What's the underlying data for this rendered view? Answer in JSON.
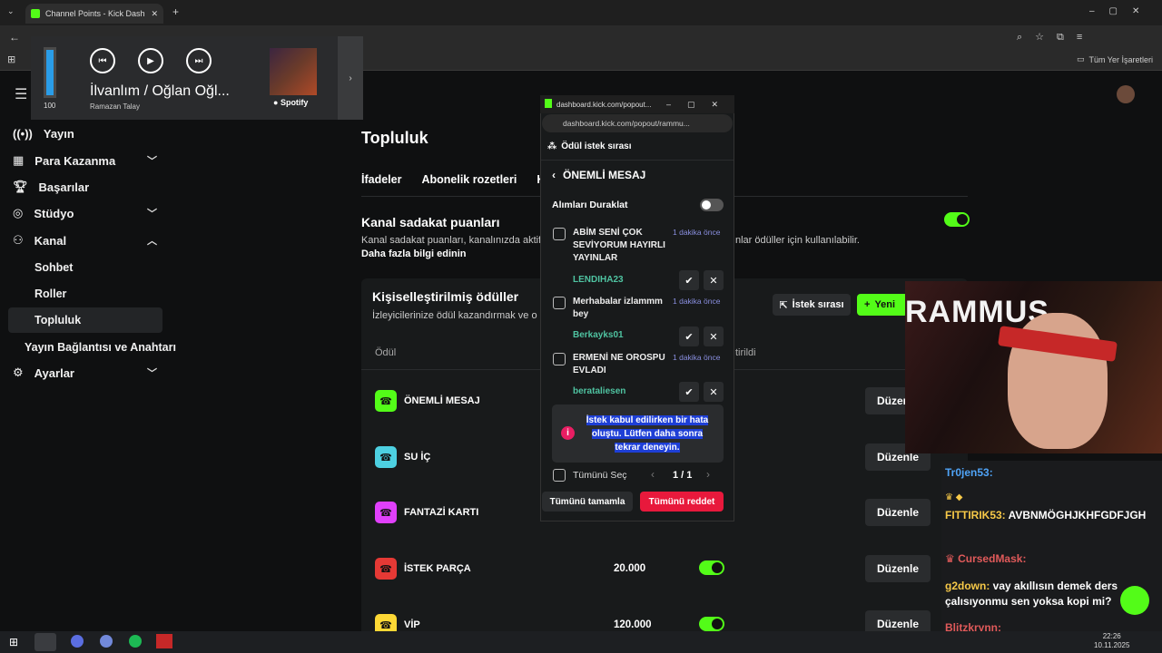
{
  "browser": {
    "tab_title": "Channel Points - Kick Dashboa",
    "bookmark_label": "Tüm Yer İşaretleri"
  },
  "spotify": {
    "volume": "100",
    "song_title": "İlvanlım / Oğlan Oğl...",
    "artist": "Ramazan Talay",
    "brand": "Spotify"
  },
  "nav": {
    "items": [
      {
        "label": "Yayın"
      },
      {
        "label": "Para Kazanma"
      },
      {
        "label": "Başarılar"
      },
      {
        "label": "Stüdyo"
      },
      {
        "label": "Kanal"
      }
    ],
    "sub_items": [
      {
        "label": "Sohbet"
      },
      {
        "label": "Roller"
      },
      {
        "label": "Topluluk"
      }
    ],
    "link": "Yayın Bağlantısı ve Anahtarı",
    "settings": "Ayarlar"
  },
  "main": {
    "title": "Topluluk",
    "tabs": [
      "İfadeler",
      "Abonelik rozetleri",
      "K"
    ],
    "loyalty_title": "Kanal sadakat puanları",
    "loyalty_desc_left": "Kanal sadakat puanları, kanalınızda aktif",
    "loyalty_desc_right": "nlar ödüller için kullanılabilir.",
    "loyalty_link": "Daha fazla bilgi edinin",
    "rewards_title": "Kişiselleştirilmiş ödüller",
    "rewards_desc": "İzleyicilerinize ödül kazandırmak ve o",
    "queue_button": "İstek sırası",
    "new_button": "Yeni",
    "col_reward": "Ödül",
    "col_status": "tirildi",
    "edit_label": "Düzenle",
    "rewards": [
      {
        "name": "ÖNEMLİ MESAJ",
        "cost": "",
        "color": "#53fc18"
      },
      {
        "name": "SU İÇ",
        "cost": "",
        "color": "#4dd0e1"
      },
      {
        "name": "FANTAZİ KARTI",
        "cost": "",
        "color": "#e040fb"
      },
      {
        "name": "İSTEK PARÇA",
        "cost": "20.000",
        "color": "#e53935"
      },
      {
        "name": "VİP",
        "cost": "120.000",
        "color": "#fdd835"
      }
    ]
  },
  "popout": {
    "window_title": "dashboard.kick.com/popout...",
    "url": "dashboard.kick.com/popout/rammu...",
    "header": "Ödül istek sırası",
    "reward_name": "ÖNEMLİ MESAJ",
    "pause_label": "Alımları Duraklat",
    "requests": [
      {
        "message": "ABİM SENİ ÇOK SEVİYORUM HAYIRLI YAYINLAR",
        "time": "1 dakika önce",
        "user": "LENDIHA23"
      },
      {
        "message": "Merhabalar izlammm bey",
        "time": "1 dakika önce",
        "user": "Berkayks01"
      },
      {
        "message": "ERMENİ NE OROSPU EVLADI",
        "time": "1 dakika önce",
        "user": "berataliesen"
      }
    ],
    "error": "İstek kabul edilirken bir hata oluştu. Lütfen daha sonra tekrar deneyin.",
    "select_all": "Tümünü Seç",
    "page": "1 / 1",
    "complete_all": "Tümünü tamamla",
    "reject_all": "Tümünü reddet"
  },
  "webcam": {
    "sign_text": "RAMMUS"
  },
  "chat": [
    {
      "user": "Tr0jen53:",
      "text": "",
      "color": "#4fa3f7"
    },
    {
      "user": "FITTIRIK53:",
      "text": "AVBNMÖGHJKHFGDFJGH",
      "color": "#f7c948"
    },
    {
      "user": "CursedMask:",
      "text": "",
      "color": "#e05a5a"
    },
    {
      "user": "g2down:",
      "text": "vay akıllısın demek ders çalısıyonmu sen yoksa kopi mi?",
      "color": "#f7c948"
    },
    {
      "user": "Blitzkrynn:",
      "text": "",
      "color": "#e05a5a"
    }
  ],
  "taskbar": {
    "time": "22:26",
    "date": "10.11.2025"
  }
}
